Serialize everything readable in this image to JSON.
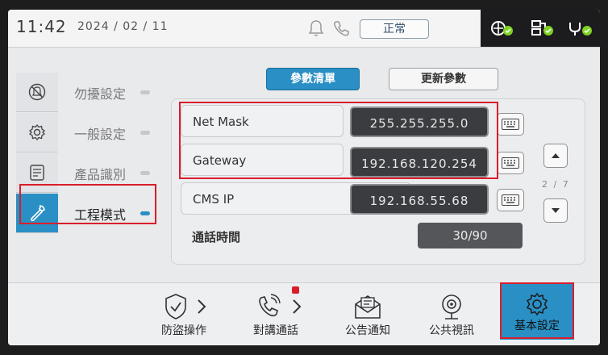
{
  "status_bar": {
    "time": "11:42",
    "date": "2024 / 02 / 11",
    "mode_badge": "正常",
    "icons": [
      "bell-icon",
      "phone-icon",
      "network-ok-icon",
      "server-ok-icon",
      "plug-ok-icon"
    ]
  },
  "sidebar": {
    "items": [
      {
        "label": "勿擾設定",
        "icon": "mute-bell-icon",
        "active": false
      },
      {
        "label": "一般設定",
        "icon": "gear-icon",
        "active": false
      },
      {
        "label": "產品識別",
        "icon": "document-icon",
        "active": false
      },
      {
        "label": "工程模式",
        "icon": "wrench-icon",
        "active": true
      }
    ]
  },
  "tabs": {
    "active": "參數清單",
    "inactive": "更新參數"
  },
  "params": [
    {
      "label": "Net Mask",
      "value": "255.255.255.0"
    },
    {
      "label": "Gateway",
      "value": "192.168.120.254"
    },
    {
      "label": "CMS IP",
      "value": "192.168.55.68"
    },
    {
      "label": "通話時間",
      "value": "30/90"
    }
  ],
  "pagination": {
    "indicator": "2 / 7"
  },
  "bottom_nav": [
    {
      "label": "防盜操作",
      "icon": "shield-check-icon"
    },
    {
      "label": "對講通話",
      "icon": "phone-call-icon"
    },
    {
      "label": "公告通知",
      "icon": "mail-notice-icon"
    },
    {
      "label": "公共視訊",
      "icon": "webcam-icon"
    },
    {
      "label": "基本設定",
      "icon": "settings-gear-icon",
      "active": true
    }
  ],
  "colors": {
    "accent": "#2a8fc4",
    "highlight": "#d91e2b",
    "value_bg": "#3b3c40",
    "status_ok": "#7ed321"
  }
}
